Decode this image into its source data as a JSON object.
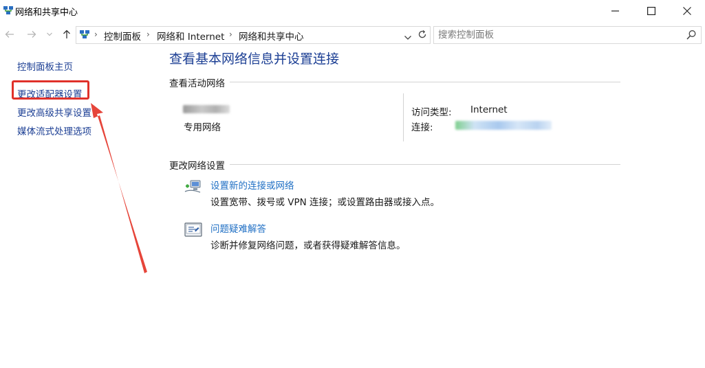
{
  "window": {
    "title": "网络和共享中心",
    "controls": {
      "minimize": "minimize-icon",
      "maximize": "maximize-icon",
      "close": "close-icon"
    }
  },
  "nav": {
    "breadcrumbs": [
      "控制面板",
      "网络和 Internet",
      "网络和共享中心"
    ],
    "search_placeholder": "搜索控制面板"
  },
  "sidebar": {
    "items": [
      {
        "label": "控制面板主页"
      },
      {
        "label": "更改适配器设置"
      },
      {
        "label": "更改高级共享设置"
      },
      {
        "label": "媒体流式处理选项"
      }
    ]
  },
  "main": {
    "title": "查看基本网络信息并设置连接",
    "active_section": "查看活动网络",
    "network": {
      "type_label": "专用网络",
      "access_type_label": "访问类型:",
      "access_type_value": "Internet",
      "connection_label": "连接:"
    },
    "change_section": "更改网络设置",
    "tasks": [
      {
        "link": "设置新的连接或网络",
        "desc": "设置宽带、拨号或 VPN 连接；或设置路由器或接入点。",
        "icon": "network-setup-icon"
      },
      {
        "link": "问题疑难解答",
        "desc": "诊断并修复网络问题，或者获得疑难解答信息。",
        "icon": "troubleshoot-icon"
      }
    ]
  },
  "colors": {
    "link": "#1c3f94",
    "task_link": "#1f6fc4",
    "highlight": "#e0312a"
  }
}
